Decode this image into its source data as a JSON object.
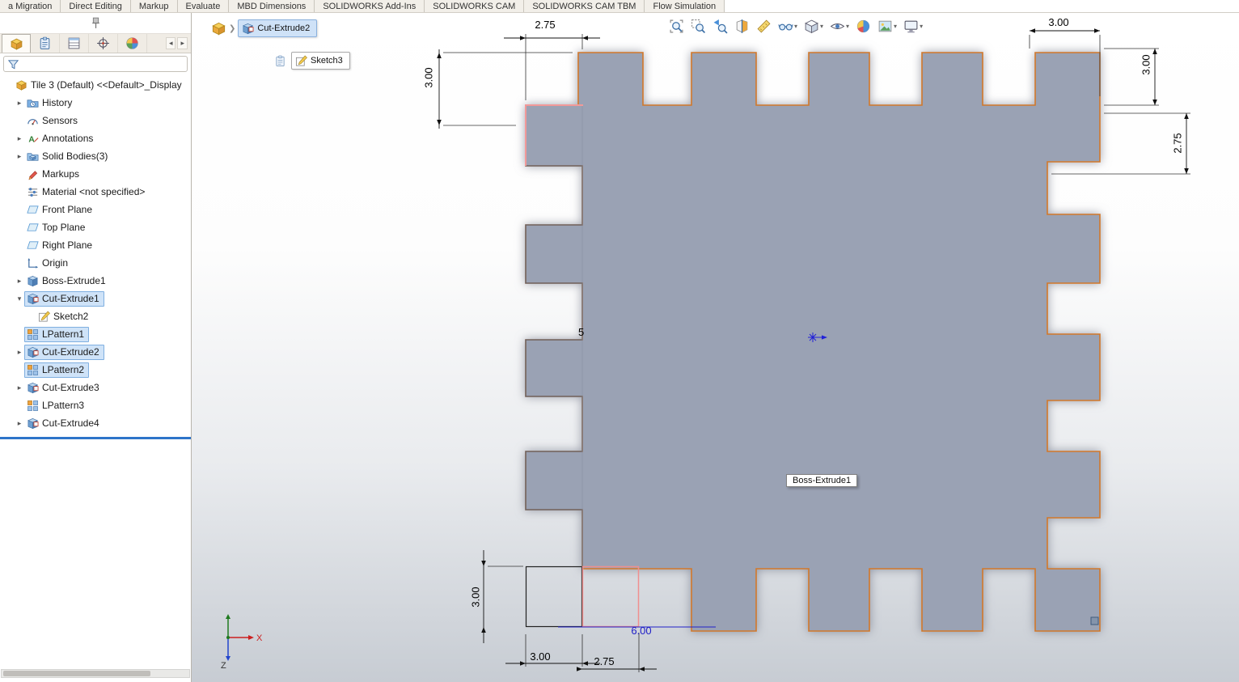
{
  "app": {
    "name": "SOLIDWORKS"
  },
  "colors": {
    "selection_fill": "#cfe3f8",
    "selection_border": "#7fafe0",
    "part_fill": "#9aa2b4",
    "part_edge_orange": "#d2782a",
    "sketch_highlight_pink": "#f19999",
    "sketch_dimension_blue": "#2121c8",
    "rollback_bar_blue": "#2e74c9",
    "viewport_gradient_bottom": "#c7ccd3"
  },
  "menubar": {
    "tabs": [
      "a Migration",
      "Direct Editing",
      "Markup",
      "Evaluate",
      "MBD Dimensions",
      "SOLIDWORKS Add-Ins",
      "SOLIDWORKS CAM",
      "SOLIDWORKS CAM TBM",
      "Flow Simulation"
    ]
  },
  "left_panel": {
    "tabs": [
      {
        "name": "feature-manager",
        "icon": "part",
        "active": true
      },
      {
        "name": "property-manager",
        "icon": "clipboard",
        "active": false
      },
      {
        "name": "configuration-manager",
        "icon": "list",
        "active": false
      },
      {
        "name": "dimxpert-manager",
        "icon": "target",
        "active": false
      },
      {
        "name": "display-manager",
        "icon": "pie",
        "active": false
      }
    ],
    "nav_prev": "◂",
    "nav_next": "▸",
    "filter": {
      "placeholder": ""
    },
    "tree": [
      {
        "label": "Tile 3 (Default) <<Default>_Display",
        "icon": "part",
        "level": 0,
        "arrow": null,
        "selected": false
      },
      {
        "label": "History",
        "icon": "history",
        "level": 1,
        "arrow": "right",
        "selected": false
      },
      {
        "label": "Sensors",
        "icon": "sensors",
        "level": 1,
        "arrow": null,
        "selected": false
      },
      {
        "label": "Annotations",
        "icon": "annotations",
        "level": 1,
        "arrow": "right",
        "selected": false
      },
      {
        "label": "Solid Bodies(3)",
        "icon": "solid-bodies",
        "level": 1,
        "arrow": "right",
        "selected": false
      },
      {
        "label": "Markups",
        "icon": "markups",
        "level": 1,
        "arrow": null,
        "selected": false
      },
      {
        "label": "Material <not specified>",
        "icon": "material",
        "level": 1,
        "arrow": null,
        "selected": false
      },
      {
        "label": "Front Plane",
        "icon": "plane",
        "level": 1,
        "arrow": null,
        "selected": false
      },
      {
        "label": "Top Plane",
        "icon": "plane",
        "level": 1,
        "arrow": null,
        "selected": false
      },
      {
        "label": "Right Plane",
        "icon": "plane",
        "level": 1,
        "arrow": null,
        "selected": false
      },
      {
        "label": "Origin",
        "icon": "origin",
        "level": 1,
        "arrow": null,
        "selected": false
      },
      {
        "label": "Boss-Extrude1",
        "icon": "boss-extrude",
        "level": 1,
        "arrow": "right",
        "selected": false
      },
      {
        "label": "Cut-Extrude1",
        "icon": "cut-extrude",
        "level": 1,
        "arrow": "down",
        "selected": true
      },
      {
        "label": "Sketch2",
        "icon": "sketch",
        "level": 2,
        "arrow": null,
        "selected": false
      },
      {
        "label": "LPattern1",
        "icon": "pattern",
        "level": 1,
        "arrow": null,
        "selected": true
      },
      {
        "label": "Cut-Extrude2",
        "icon": "cut-extrude",
        "level": 1,
        "arrow": "right",
        "selected": true
      },
      {
        "label": "LPattern2",
        "icon": "pattern",
        "level": 1,
        "arrow": null,
        "selected": true
      },
      {
        "label": "Cut-Extrude3",
        "icon": "cut-extrude",
        "level": 1,
        "arrow": "right",
        "selected": false
      },
      {
        "label": "LPattern3",
        "icon": "pattern",
        "level": 1,
        "arrow": null,
        "selected": false
      },
      {
        "label": "Cut-Extrude4",
        "icon": "cut-extrude",
        "level": 1,
        "arrow": "right",
        "selected": false
      }
    ]
  },
  "viewport": {
    "breadcrumb": {
      "feature": "Cut-Extrude2",
      "sketch": "Sketch3"
    },
    "hud_buttons": [
      {
        "name": "zoom-to-fit",
        "icon": "zoom-fit",
        "caret": false
      },
      {
        "name": "zoom-to-area",
        "icon": "zoom-area",
        "caret": false
      },
      {
        "name": "previous-view",
        "icon": "prev",
        "caret": false
      },
      {
        "name": "section-view",
        "icon": "section",
        "caret": false
      },
      {
        "name": "measure",
        "icon": "measure",
        "caret": false
      },
      {
        "name": "hide-show-items",
        "icon": "glasses",
        "caret": true
      },
      {
        "name": "display-style",
        "icon": "cube",
        "caret": true
      },
      {
        "name": "view-settings",
        "icon": "eye",
        "caret": true
      },
      {
        "name": "edit-appearance",
        "icon": "ball",
        "caret": false
      },
      {
        "name": "apply-scene",
        "icon": "scene",
        "caret": true
      },
      {
        "name": "view-display",
        "icon": "monitor",
        "caret": true
      }
    ],
    "tooltip": "Boss-Extrude1",
    "dimensions": {
      "top": "2.75",
      "top_left": "3.00",
      "top_right": "3.00",
      "right_upper": "3.00",
      "right_lower": "2.75",
      "bottom_left": "3.00",
      "bottom_width": "3.00",
      "bottom_offset": "2.75",
      "sketch_length": "6.00",
      "edge_digit": "5"
    },
    "triad": {
      "x_label": "X",
      "z_label": "Z"
    }
  }
}
